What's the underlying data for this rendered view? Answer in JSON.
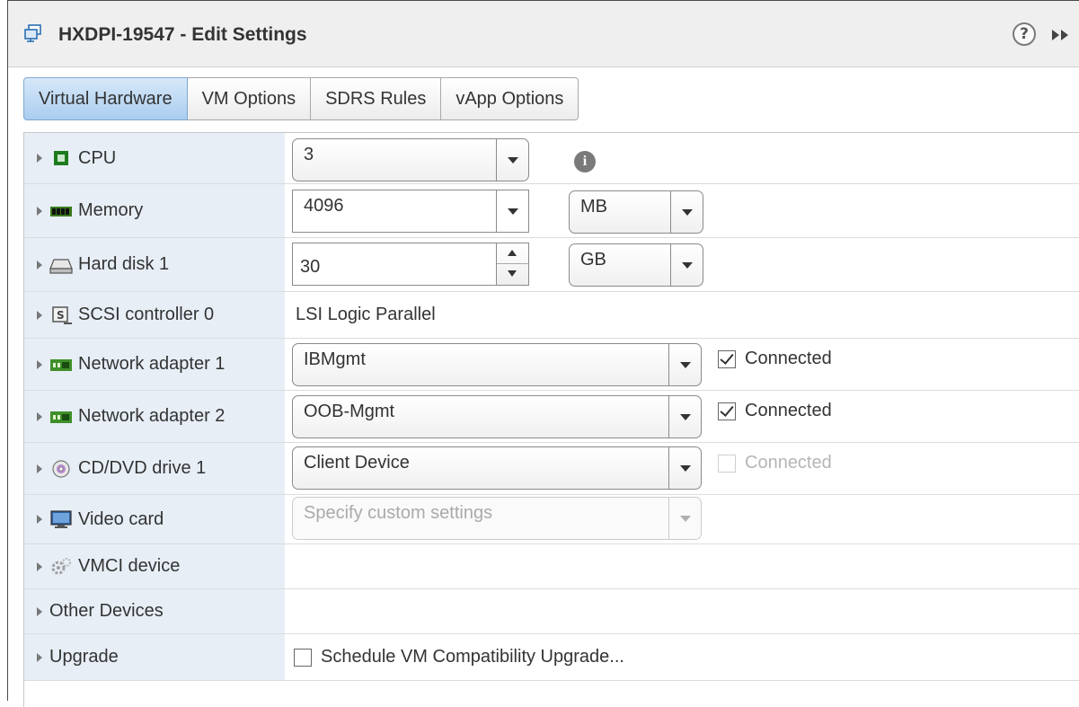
{
  "window": {
    "title": "HXDPI-19547 - Edit Settings",
    "help_symbol": "?"
  },
  "tabs": [
    {
      "label": "Virtual Hardware",
      "active": true
    },
    {
      "label": "VM Options",
      "active": false
    },
    {
      "label": "SDRS Rules",
      "active": false
    },
    {
      "label": "vApp Options",
      "active": false
    }
  ],
  "hardware": {
    "cpu": {
      "label": "CPU",
      "value": "3",
      "info_symbol": "i"
    },
    "memory": {
      "label": "Memory",
      "value": "4096",
      "unit": "MB"
    },
    "hard_disk": {
      "label": "Hard disk 1",
      "value": "30",
      "unit": "GB"
    },
    "scsi": {
      "label": "SCSI controller 0",
      "value": "LSI Logic Parallel"
    },
    "net1": {
      "label": "Network adapter 1",
      "value": "IBMgmt",
      "connected_label": "Connected",
      "connected": true
    },
    "net2": {
      "label": "Network adapter 2",
      "value": "OOB-Mgmt",
      "connected_label": "Connected",
      "connected": true
    },
    "cddvd": {
      "label": "CD/DVD drive 1",
      "value": "Client Device",
      "connected_label": "Connected",
      "connected": false
    },
    "video": {
      "label": "Video card",
      "value": "Specify custom settings"
    },
    "vmci": {
      "label": "VMCI device"
    },
    "other": {
      "label": "Other Devices"
    },
    "upgrade": {
      "label": "Upgrade",
      "checkbox_label": "Schedule VM Compatibility Upgrade...",
      "checked": false
    }
  },
  "colors": {
    "active_tab": "#aacdef",
    "label_column_bg": "#e7eef6",
    "titlebar_bg": "#efefef"
  }
}
